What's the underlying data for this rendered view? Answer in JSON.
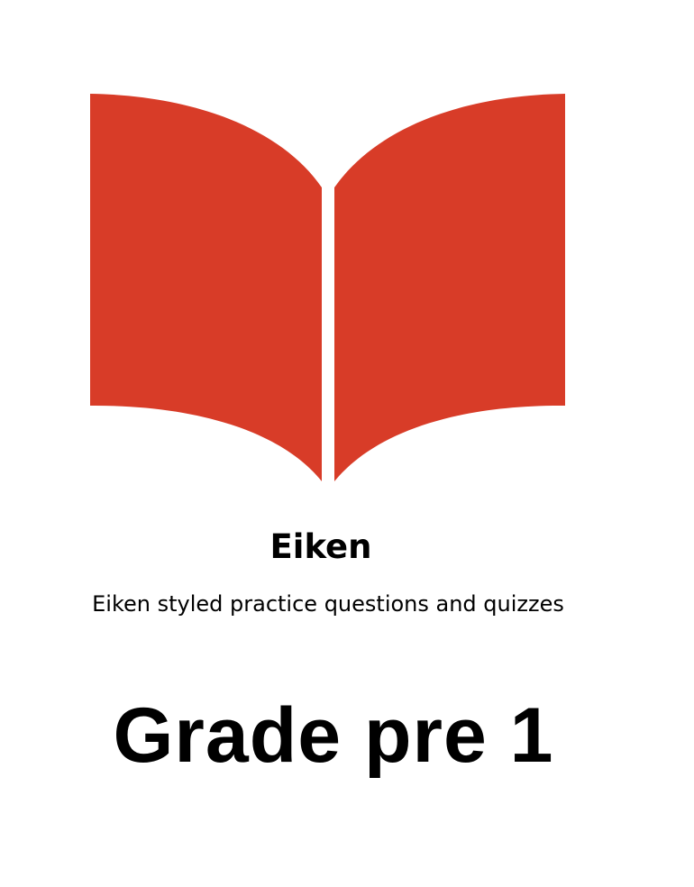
{
  "logo": {
    "icon": "open-book-icon",
    "color": "#D83C28"
  },
  "title": "Eiken",
  "subtitle": "Eiken styled practice questions and quizzes",
  "grade": "Grade pre 1"
}
